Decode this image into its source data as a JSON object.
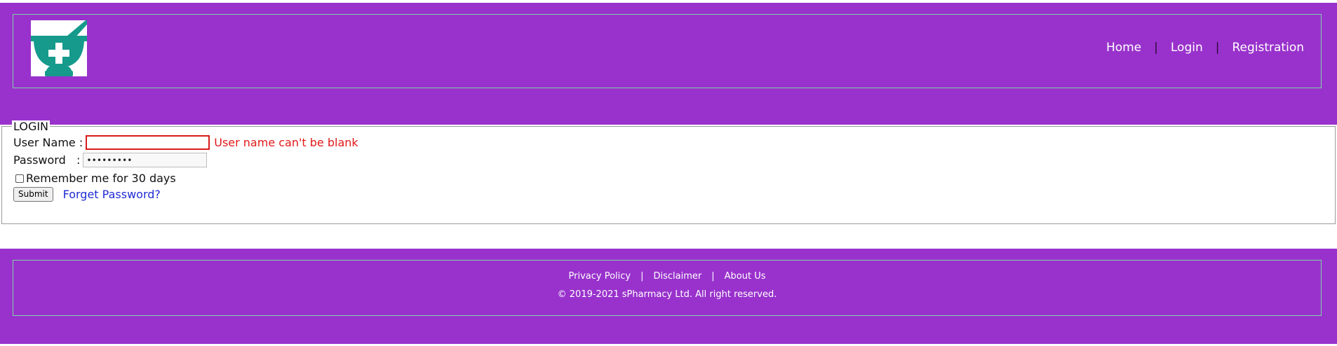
{
  "colors": {
    "brand_purple": "#9932cc",
    "error_red": "#e21919",
    "link_blue": "#1f2bd4",
    "logo_teal": "#159a8c"
  },
  "header": {
    "logo_icon": "mortar-pestle-cross-icon",
    "nav": [
      {
        "label": "Home"
      },
      {
        "label": "Login"
      },
      {
        "label": "Registration"
      }
    ],
    "nav_separator": "|"
  },
  "login": {
    "legend": "LOGIN",
    "username_label": "User Name :",
    "username_value": "",
    "username_error": "User name can't be blank",
    "password_label": "Password   :",
    "password_value": "•••••••••",
    "remember_label": "Remember me for 30 days",
    "remember_checked": false,
    "submit_label": "Submit",
    "forget_label": "Forget Password?"
  },
  "footer": {
    "links": [
      {
        "label": "Privacy Policy"
      },
      {
        "label": "Disclaimer"
      },
      {
        "label": "About Us"
      }
    ],
    "separator": "|",
    "copyright": "© 2019-2021 sPharmacy Ltd. All right reserved."
  }
}
